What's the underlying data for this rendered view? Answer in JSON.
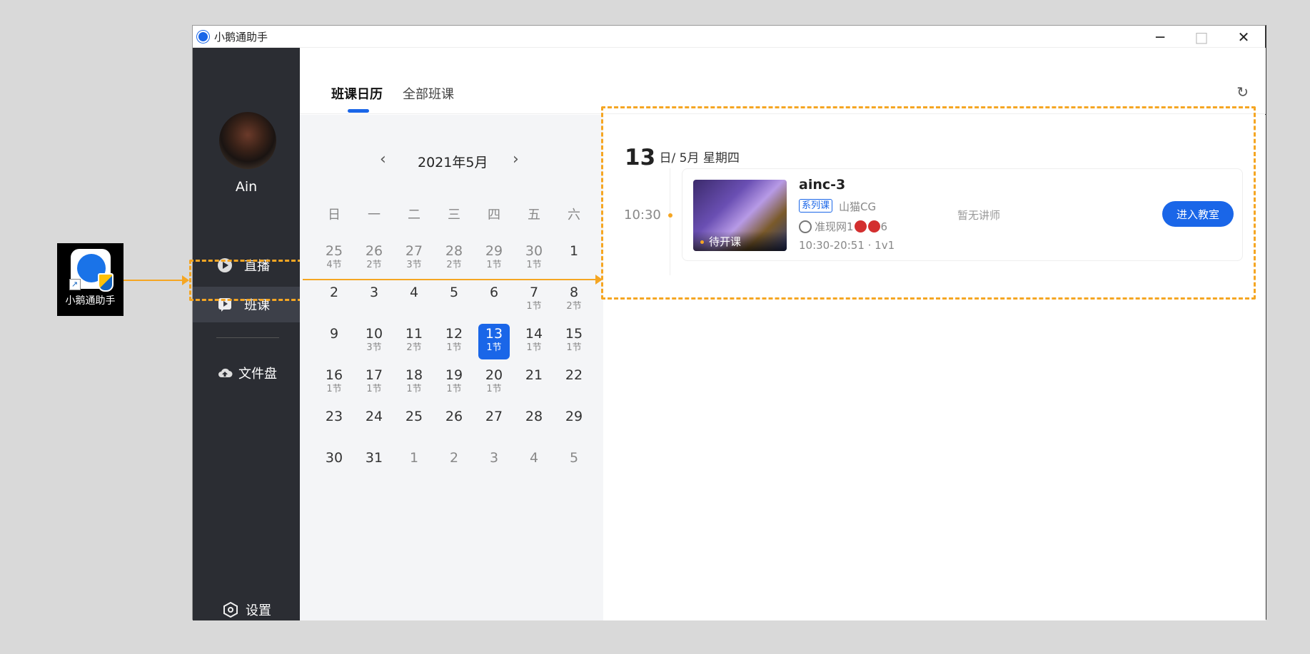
{
  "desktop_icon": {
    "label": "小鹅通助手"
  },
  "window": {
    "title": "小鹅通助手",
    "minimize": "─",
    "maximize": "□",
    "close": "✕"
  },
  "sidebar": {
    "username": "Ain",
    "items": [
      {
        "label": "直播",
        "icon": "play-icon"
      },
      {
        "label": "班课",
        "icon": "class-icon"
      },
      {
        "label": "文件盘",
        "icon": "cloud-icon"
      }
    ],
    "settings_label": "设置"
  },
  "tabs": [
    {
      "label": "班课日历"
    },
    {
      "label": "全部班课"
    }
  ],
  "calendar": {
    "month_label": "2021年5月",
    "prev": "‹",
    "next": "›",
    "weekdays": [
      "日",
      "一",
      "二",
      "三",
      "四",
      "五",
      "六"
    ],
    "weeks": [
      [
        {
          "n": "25",
          "c": "4节",
          "o": true
        },
        {
          "n": "26",
          "c": "2节",
          "o": true
        },
        {
          "n": "27",
          "c": "3节",
          "o": true
        },
        {
          "n": "28",
          "c": "2节",
          "o": true
        },
        {
          "n": "29",
          "c": "1节",
          "o": true
        },
        {
          "n": "30",
          "c": "1节",
          "o": true
        },
        {
          "n": "1",
          "c": ""
        }
      ],
      [
        {
          "n": "2",
          "c": ""
        },
        {
          "n": "3",
          "c": ""
        },
        {
          "n": "4",
          "c": ""
        },
        {
          "n": "5",
          "c": ""
        },
        {
          "n": "6",
          "c": ""
        },
        {
          "n": "7",
          "c": "1节"
        },
        {
          "n": "8",
          "c": "2节"
        }
      ],
      [
        {
          "n": "9",
          "c": ""
        },
        {
          "n": "10",
          "c": "3节"
        },
        {
          "n": "11",
          "c": "2节"
        },
        {
          "n": "12",
          "c": "1节"
        },
        {
          "n": "13",
          "c": "1节",
          "sel": true
        },
        {
          "n": "14",
          "c": "1节"
        },
        {
          "n": "15",
          "c": "1节"
        }
      ],
      [
        {
          "n": "16",
          "c": "1节"
        },
        {
          "n": "17",
          "c": "1节"
        },
        {
          "n": "18",
          "c": "1节"
        },
        {
          "n": "19",
          "c": "1节"
        },
        {
          "n": "20",
          "c": "1节"
        },
        {
          "n": "21",
          "c": ""
        },
        {
          "n": "22",
          "c": ""
        }
      ],
      [
        {
          "n": "23",
          "c": ""
        },
        {
          "n": "24",
          "c": ""
        },
        {
          "n": "25",
          "c": ""
        },
        {
          "n": "26",
          "c": ""
        },
        {
          "n": "27",
          "c": ""
        },
        {
          "n": "28",
          "c": ""
        },
        {
          "n": "29",
          "c": ""
        }
      ],
      [
        {
          "n": "30",
          "c": ""
        },
        {
          "n": "31",
          "c": ""
        },
        {
          "n": "1",
          "c": "",
          "o": true
        },
        {
          "n": "2",
          "c": "",
          "o": true
        },
        {
          "n": "3",
          "c": "",
          "o": true
        },
        {
          "n": "4",
          "c": "",
          "o": true
        },
        {
          "n": "5",
          "c": "",
          "o": true
        }
      ]
    ]
  },
  "detail": {
    "day": "13",
    "date_suffix": "日/ 5月  星期四",
    "time": "10:30",
    "card": {
      "status": "待开课",
      "title": "ainc-3",
      "tag": "系列课",
      "org": "山猫CG",
      "user_prefix": "准现网1",
      "user_suffix": "6",
      "time_range": "10:30-20:51 · 1v1",
      "teacher": "暂无讲师",
      "enter_label": "进入教室"
    }
  },
  "colors": {
    "accent": "#1a66e8",
    "annotation": "#f5a623",
    "sidebar": "#2b2d33"
  }
}
